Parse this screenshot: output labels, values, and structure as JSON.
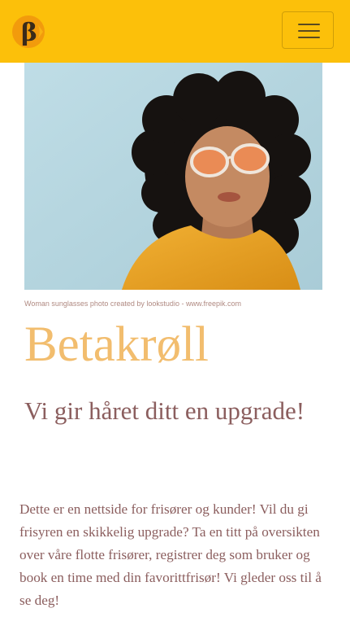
{
  "navbar": {
    "logo_letter": "β",
    "logo_color": "#fcc00a",
    "menu_icon": "hamburger-menu-icon"
  },
  "hero": {
    "image_alt": "Woman with curly hair and orange sunglasses",
    "credit": "Woman sunglasses photo created by lookstudio - www.freepik.com"
  },
  "brand": {
    "title": "Betakrøll",
    "title_color": "#f2bd6e"
  },
  "tagline": "Vi gir håret ditt en upgrade!",
  "intro": "Dette er en nettside for frisører og kunder! Vil du gi frisyren en skikkelig upgrade? Ta en titt på oversikten over våre flotte frisører, registrer deg som bruker og book en time med din favorittfrisør! Vi gleder oss til å se deg!"
}
